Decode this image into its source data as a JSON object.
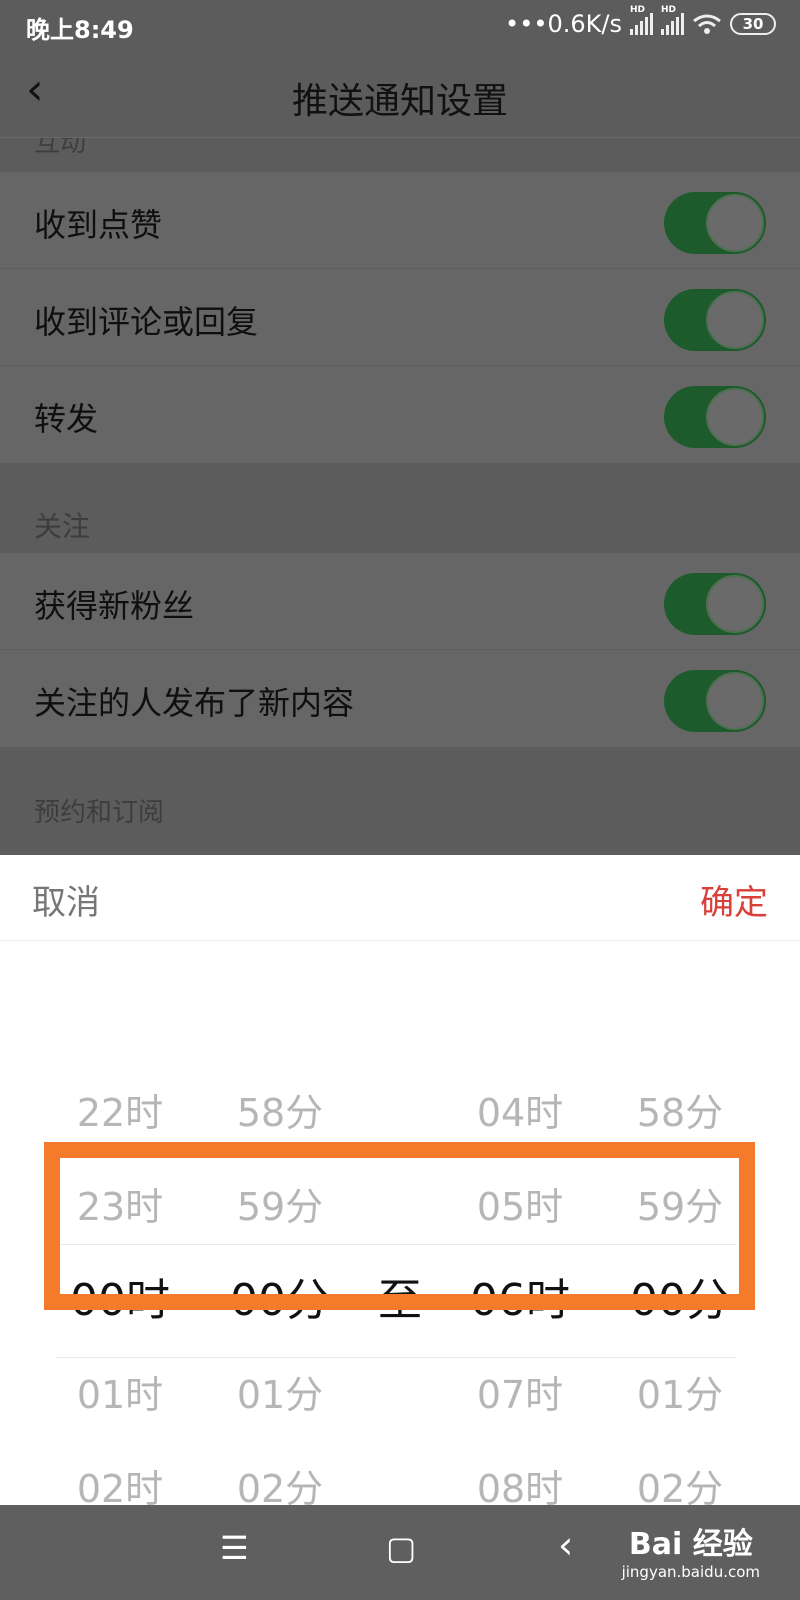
{
  "status_bar": {
    "time": "晚上8:49",
    "net_speed": "•••0.6K/s",
    "sim1_tag": "HD",
    "sim2_tag": "HD",
    "wifi_icon": "wifi-icon",
    "battery": "30"
  },
  "header": {
    "back_icon": "‹",
    "title": "推送通知设置"
  },
  "settings": {
    "interaction_section_peek": "互动",
    "interaction_items": [
      {
        "label": "收到点赞",
        "enabled": true
      },
      {
        "label": "收到评论或回复",
        "enabled": true
      },
      {
        "label": "转发",
        "enabled": true
      }
    ],
    "follow_section": "关注",
    "follow_items": [
      {
        "label": "获得新粉丝",
        "enabled": true
      },
      {
        "label": "关注的人发布了新内容",
        "enabled": true
      }
    ],
    "subscribe_section": "预约和订阅"
  },
  "picker": {
    "cancel_label": "取消",
    "confirm_label": "确定",
    "start_hour": {
      "items": [
        "22时",
        "23时",
        "00时",
        "01时",
        "02时"
      ],
      "selected": "00时"
    },
    "start_minute": {
      "items": [
        "58分",
        "59分",
        "00分",
        "01分",
        "02分"
      ],
      "selected": "00分"
    },
    "separator": "至",
    "end_hour": {
      "items": [
        "04时",
        "05时",
        "06时",
        "07时",
        "08时"
      ],
      "selected": "06时"
    },
    "end_minute": {
      "items": [
        "58分",
        "59分",
        "00分",
        "01分",
        "02分"
      ],
      "selected": "00分"
    }
  },
  "nav_bar": {
    "menu_icon": "☰",
    "home_icon": "▢",
    "back_icon": "‹"
  },
  "watermark": {
    "brand": "Bai 经验",
    "url": "jingyan.baidu.com"
  },
  "colors": {
    "toggle_on": "#1d5a2c",
    "confirm": "#d9403a",
    "highlight_box": "#f57b2b"
  }
}
